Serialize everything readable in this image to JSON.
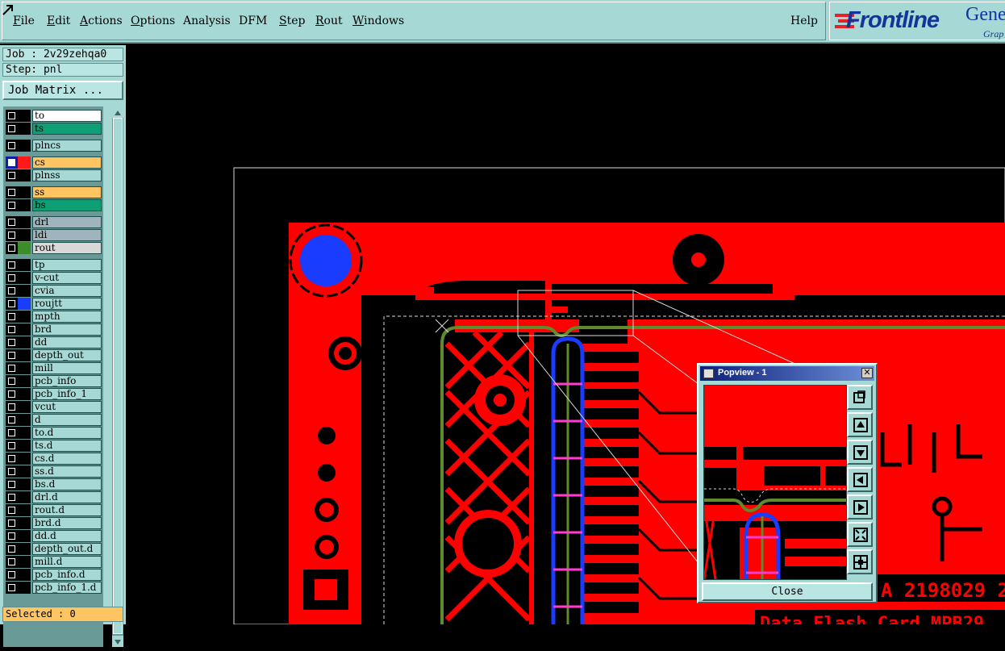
{
  "menubar": {
    "items": [
      {
        "label": "File",
        "u": "F",
        "rest": "ile"
      },
      {
        "label": "Edit",
        "u": "E",
        "rest": "dit"
      },
      {
        "label": "Actions",
        "u": "A",
        "rest": "ctions"
      },
      {
        "label": "Options",
        "u": "O",
        "rest": "ptions"
      },
      {
        "label": "Analysis",
        "u": "",
        "rest": "Analysis"
      },
      {
        "label": "DFM",
        "u": "",
        "rest": "DFM"
      },
      {
        "label": "Step",
        "u": "S",
        "rest": "tep"
      },
      {
        "label": "Rout",
        "u": "R",
        "rest": "out"
      },
      {
        "label": "Windows",
        "u": "W",
        "rest": "indows"
      }
    ],
    "help": "Help"
  },
  "logo": {
    "brand": "Frontline",
    "product": "Gene",
    "sub": "Grap"
  },
  "sidebar": {
    "job": "Job : 2v29zehqa0",
    "step": "Step: pnl",
    "job_matrix_button": "Job Matrix ...",
    "layers": [
      {
        "name": "to",
        "color": "#ffffff",
        "swatch": "#000000",
        "selected": false
      },
      {
        "name": "ts",
        "color": "#0f9f74",
        "swatch": "#000000",
        "selected": false
      },
      {
        "name": "plncs",
        "color": "#a6d9d6",
        "swatch": "#000000",
        "selected": false
      },
      {
        "name": "cs",
        "color": "#ffc562",
        "swatch": "#ff1a1a",
        "selected": true
      },
      {
        "name": "plnss",
        "color": "#a6d9d6",
        "swatch": "#000000",
        "selected": false
      },
      {
        "name": "ss",
        "color": "#ffc562",
        "swatch": "#000000",
        "selected": false
      },
      {
        "name": "bs",
        "color": "#0f9f74",
        "swatch": "#000000",
        "selected": false
      },
      {
        "name": "drl",
        "color": "#9fb4bc",
        "swatch": "#000000",
        "selected": false
      },
      {
        "name": "ldi",
        "color": "#9fb4bc",
        "swatch": "#000000",
        "selected": false
      },
      {
        "name": "rout",
        "color": "#d8d8d8",
        "swatch": "#3c8d2a",
        "selected": false
      },
      {
        "name": "tp",
        "color": "#a6d9d6",
        "swatch": "#000000",
        "selected": false
      },
      {
        "name": "v-cut",
        "color": "#a6d9d6",
        "swatch": "#000000",
        "selected": false
      },
      {
        "name": "cvia",
        "color": "#a6d9d6",
        "swatch": "#000000",
        "selected": false
      },
      {
        "name": "roujtt",
        "color": "#a6d9d6",
        "swatch": "#1a3cff",
        "selected": false
      },
      {
        "name": "mpth",
        "color": "#a6d9d6",
        "swatch": "#000000",
        "selected": false
      },
      {
        "name": "brd",
        "color": "#a6d9d6",
        "swatch": "#000000",
        "selected": false
      },
      {
        "name": "dd",
        "color": "#a6d9d6",
        "swatch": "#000000",
        "selected": false
      },
      {
        "name": "depth_out",
        "color": "#a6d9d6",
        "swatch": "#000000",
        "selected": false
      },
      {
        "name": "mill",
        "color": "#a6d9d6",
        "swatch": "#000000",
        "selected": false
      },
      {
        "name": "pcb_info",
        "color": "#a6d9d6",
        "swatch": "#000000",
        "selected": false
      },
      {
        "name": "pcb_info_1",
        "color": "#a6d9d6",
        "swatch": "#000000",
        "selected": false
      },
      {
        "name": "vcut",
        "color": "#a6d9d6",
        "swatch": "#000000",
        "selected": false
      },
      {
        "name": "d",
        "color": "#a6d9d6",
        "swatch": "#000000",
        "selected": false
      },
      {
        "name": "to.d",
        "color": "#a6d9d6",
        "swatch": "#000000",
        "selected": false
      },
      {
        "name": "ts.d",
        "color": "#a6d9d6",
        "swatch": "#000000",
        "selected": false
      },
      {
        "name": "cs.d",
        "color": "#a6d9d6",
        "swatch": "#000000",
        "selected": false
      },
      {
        "name": "ss.d",
        "color": "#a6d9d6",
        "swatch": "#000000",
        "selected": false
      },
      {
        "name": "bs.d",
        "color": "#a6d9d6",
        "swatch": "#000000",
        "selected": false
      },
      {
        "name": "drl.d",
        "color": "#a6d9d6",
        "swatch": "#000000",
        "selected": false
      },
      {
        "name": "rout.d",
        "color": "#a6d9d6",
        "swatch": "#000000",
        "selected": false
      },
      {
        "name": "brd.d",
        "color": "#a6d9d6",
        "swatch": "#000000",
        "selected": false
      },
      {
        "name": "dd.d",
        "color": "#a6d9d6",
        "swatch": "#000000",
        "selected": false
      },
      {
        "name": "depth_out.d",
        "color": "#a6d9d6",
        "swatch": "#000000",
        "selected": false
      },
      {
        "name": "mill.d",
        "color": "#a6d9d6",
        "swatch": "#000000",
        "selected": false
      },
      {
        "name": "pcb_info.d",
        "color": "#a6d9d6",
        "swatch": "#000000",
        "selected": false
      },
      {
        "name": "pcb_info_1.d",
        "color": "#a6d9d6",
        "swatch": "#000000",
        "selected": false
      }
    ],
    "selected_status": "Selected : 0"
  },
  "board": {
    "colors": {
      "copper": "#ff0000",
      "background": "#000000",
      "route": "#5f8a2e",
      "blue": "#1a3cff",
      "magenta": "#ff3bd0"
    },
    "silk_text_1": "A 2198029 2",
    "silk_text_2": "Data Flash Card MPB29"
  },
  "popview": {
    "title": "Popview - 1",
    "close_label": "Close",
    "tools": [
      "zoom-home-icon",
      "pan-up-icon",
      "pan-down-icon",
      "pan-left-icon",
      "pan-right-icon",
      "zoom-in-icon",
      "zoom-out-icon"
    ]
  }
}
